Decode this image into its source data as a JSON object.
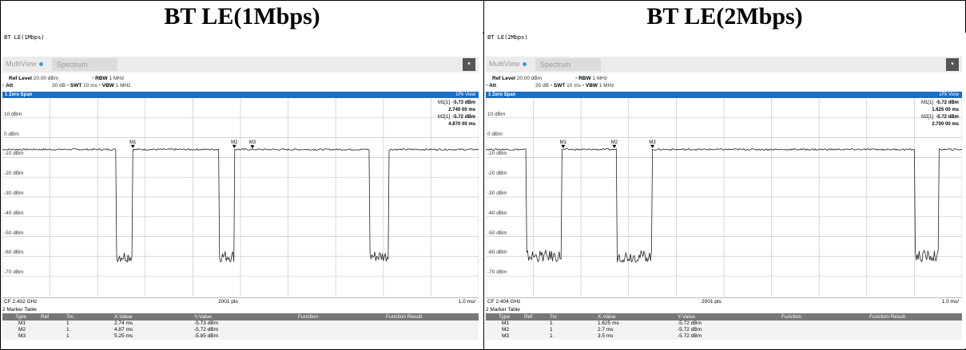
{
  "headers": [
    "BT LE(1Mbps)",
    "BT LE(2Mbps)"
  ],
  "panels": [
    {
      "title": "BT LE(1Mbps)",
      "tabs": {
        "multiview": "MultiView",
        "spectrum": "Spectrum"
      },
      "params": {
        "ref_level_label": "Ref Level",
        "ref_level": "20.00 dBm",
        "att_label": "Att",
        "att": "30 dB",
        "swt_label": "SWT",
        "swt": "10 ms",
        "rbw_label": "RBW",
        "rbw": "1 MHz",
        "vbw_label": "VBW",
        "vbw": "1 MHz"
      },
      "window_title": "1 Zero Span",
      "trace_label": "1Pk View",
      "y_labels": [
        "10 dBm",
        "0 dBm",
        "-10 dBm",
        "-20 dBm",
        "-30 dBm",
        "-40 dBm",
        "-50 dBm",
        "-60 dBm",
        "-70 dBm"
      ],
      "marker_info": [
        {
          "label": "M1[1]",
          "y": "-5.73 dBm",
          "x": "2.740 00 ms"
        },
        {
          "label": "M2[1]",
          "y": "-5.72 dBm",
          "x": "4.870 00 ms"
        }
      ],
      "marker_flags": [
        "M1",
        "M2",
        "M3"
      ],
      "footer": {
        "cf": "CF 2.402 GHz",
        "pts": "2001 pts",
        "div": "1.0 ms/"
      },
      "marker_table_title": "2 Marker Table",
      "table_headers": [
        "Type",
        "Ref",
        "Trc",
        "X-Value",
        "Y-Value",
        "Function",
        "Function Result"
      ],
      "table_rows": [
        [
          "M1",
          "",
          "1",
          "2.74 ms",
          "-5.73 dBm"
        ],
        [
          "M2",
          "",
          "1",
          "4.87 ms",
          "-5.72 dBm"
        ],
        [
          "M3",
          "",
          "1",
          "5.25 ms",
          "-5.85 dBm"
        ]
      ],
      "chart_data": {
        "type": "line",
        "x_unit": "ms",
        "xlim": [
          0,
          10
        ],
        "ylim": [
          -80,
          20
        ],
        "tick_labels_y": [
          "10 dBm",
          "0 dBm",
          "-10 dBm",
          "-20 dBm",
          "-30 dBm",
          "-40 dBm",
          "-50 dBm",
          "-60 dBm",
          "-70 dBm"
        ],
        "grid": true,
        "series": [
          {
            "high_level": -6,
            "low_level": -60,
            "high_segments": [
              [
                0,
                2.4
              ],
              [
                2.74,
                4.55
              ],
              [
                4.87,
                7.7
              ],
              [
                8.1,
                10
              ]
            ],
            "markers": [
              {
                "name": "M1",
                "x": 2.74,
                "y": -5.73
              },
              {
                "name": "M2",
                "x": 4.87,
                "y": -5.72
              },
              {
                "name": "M3",
                "x": 5.25,
                "y": -5.85
              }
            ]
          }
        ]
      }
    },
    {
      "title": "BT LE(2Mbps)",
      "tabs": {
        "multiview": "MultiView",
        "spectrum": "Spectrum"
      },
      "params": {
        "ref_level_label": "Ref Level",
        "ref_level": "20.00 dBm",
        "att_label": "Att",
        "att": "30 dB",
        "swt_label": "SWT",
        "swt": "10 ms",
        "rbw_label": "RBW",
        "rbw": "1 MHz",
        "vbw_label": "VBW",
        "vbw": "1 MHz"
      },
      "window_title": "1 Zero Span",
      "trace_label": "1Pk View",
      "y_labels": [
        "10 dBm",
        "0 dBm",
        "-10 dBm",
        "-20 dBm",
        "-30 dBm",
        "-40 dBm",
        "-50 dBm",
        "-60 dBm",
        "-70 dBm"
      ],
      "marker_info": [
        {
          "label": "M1[1]",
          "y": "-5.72 dBm",
          "x": "1.625 00 ms"
        },
        {
          "label": "M2[1]",
          "y": "-5.72 dBm",
          "x": "2.700 00 ms"
        }
      ],
      "marker_flags": [
        "M1",
        "M2",
        "M3"
      ],
      "footer": {
        "cf": "CF 2.404 GHz",
        "pts": "2001 pts",
        "div": "1.0 ms/"
      },
      "marker_table_title": "2 Marker Table",
      "table_headers": [
        "Type",
        "Ref",
        "Trc",
        "X-Value",
        "Y-Value",
        "Function",
        "Function Result"
      ],
      "table_rows": [
        [
          "M1",
          "",
          "1",
          "1.625 ms",
          "-5.72 dBm"
        ],
        [
          "M2",
          "",
          "1",
          "2.7 ms",
          "-5.72 dBm"
        ],
        [
          "M3",
          "",
          "1",
          "3.5 ms",
          "-5.72 dBm"
        ]
      ],
      "chart_data": {
        "type": "line",
        "x_unit": "ms",
        "xlim": [
          0,
          10
        ],
        "ylim": [
          -80,
          20
        ],
        "tick_labels_y": [
          "10 dBm",
          "0 dBm",
          "-10 dBm",
          "-20 dBm",
          "-30 dBm",
          "-40 dBm",
          "-50 dBm",
          "-60 dBm",
          "-70 dBm"
        ],
        "grid": true,
        "series": [
          {
            "high_level": -6,
            "low_level": -60,
            "high_segments": [
              [
                0,
                0.85
              ],
              [
                1.6,
                2.75
              ],
              [
                3.5,
                5.4
              ],
              [
                5.4,
                7.2
              ],
              [
                7.2,
                9.0
              ],
              [
                9.5,
                10
              ]
            ],
            "markers": [
              {
                "name": "M1",
                "x": 1.625,
                "y": -5.72
              },
              {
                "name": "M2",
                "x": 2.7,
                "y": -5.72
              },
              {
                "name": "M3",
                "x": 3.5,
                "y": -5.72
              }
            ]
          }
        ]
      }
    }
  ]
}
